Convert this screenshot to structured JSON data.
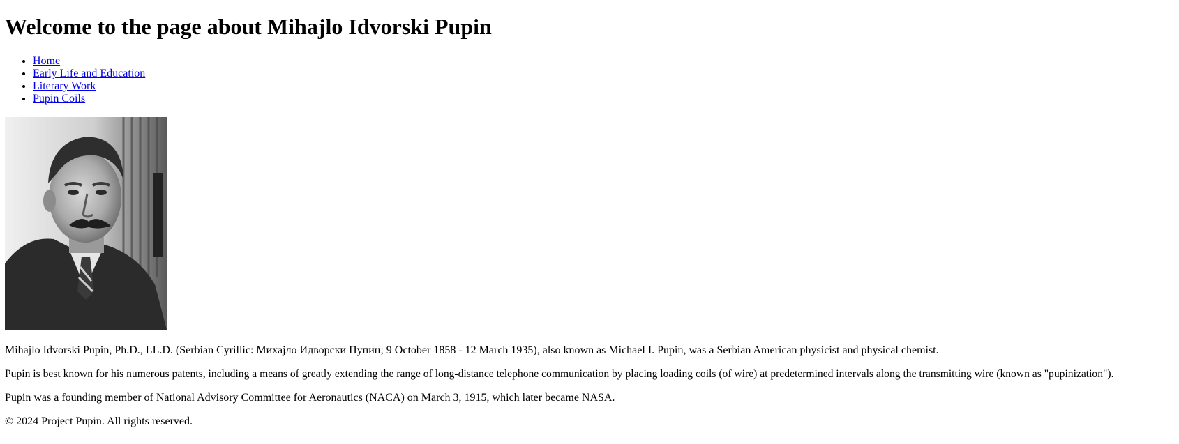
{
  "header": {
    "title": "Welcome to the page about Mihajlo Idvorski Pupin"
  },
  "nav": {
    "items": [
      {
        "label": "Home"
      },
      {
        "label": "Early Life and Education"
      },
      {
        "label": "Literary Work"
      },
      {
        "label": "Pupin Coils"
      }
    ]
  },
  "main": {
    "paragraphs": [
      "Mihajlo Idvorski Pupin, Ph.D., LL.D. (Serbian Cyrillic: Михајло Идворски Пупин; 9 October 1858 - 12 March 1935), also known as Michael I. Pupin, was a Serbian American physicist and physical chemist.",
      "Pupin is best known for his numerous patents, including a means of greatly extending the range of long-distance telephone communication by placing loading coils (of wire) at predetermined intervals along the transmitting wire (known as \"pupinization\").",
      "Pupin was a founding member of National Advisory Committee for Aeronautics (NACA) on March 3, 1915, which later became NASA."
    ]
  },
  "footer": {
    "text": "© 2024 Project Pupin. All rights reserved."
  },
  "colors": {
    "link": "#0000ee",
    "text": "#000000",
    "background": "#ffffff"
  }
}
